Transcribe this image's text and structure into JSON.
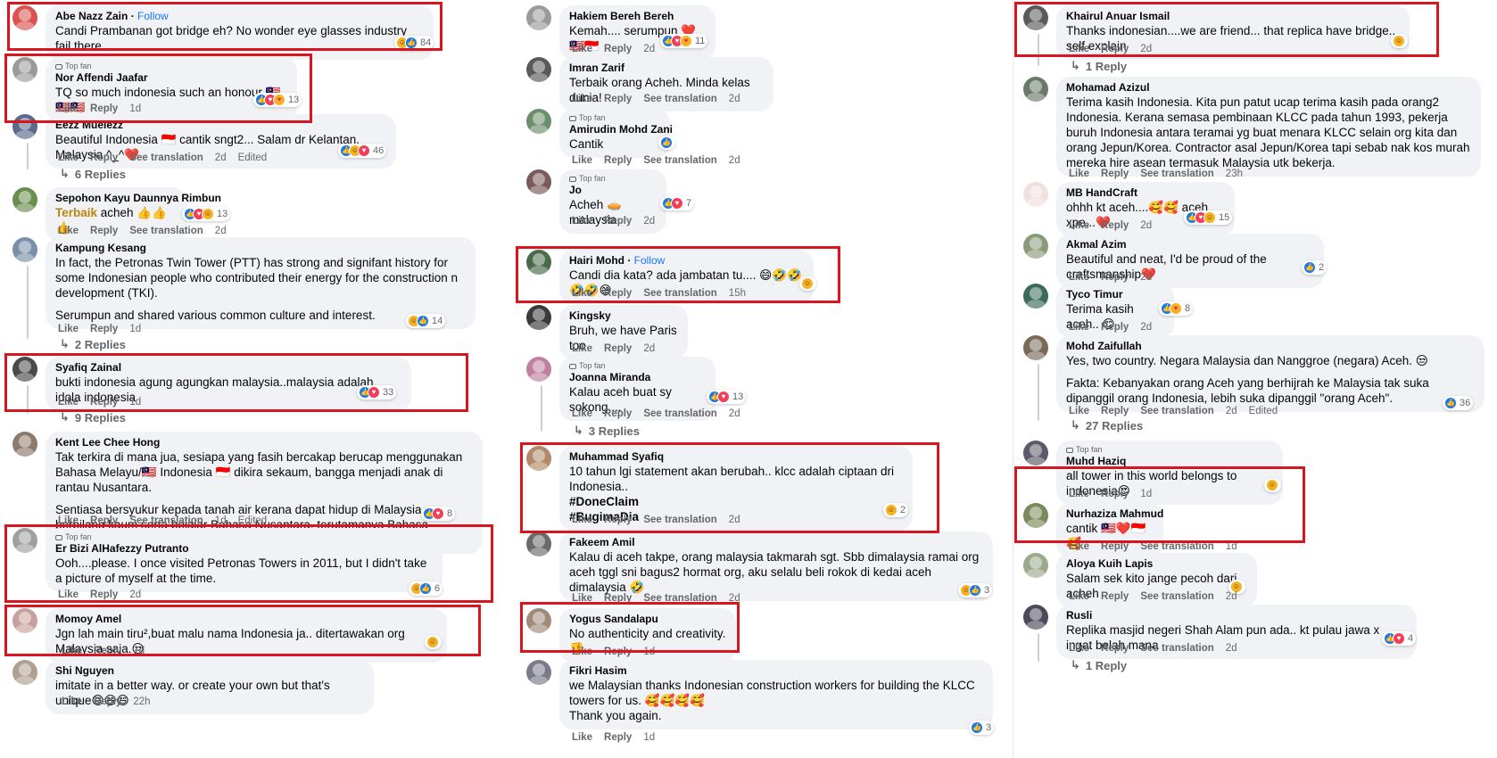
{
  "ui": {
    "like": "Like",
    "reply": "Reply",
    "see_translation": "See translation",
    "edited": "Edited",
    "top_fan": "Top fan",
    "follow": "Follow",
    "highlight_color": "#d9161f",
    "link_color": "#1877f2"
  },
  "columns": [
    {
      "comments": [
        {
          "name": "Abe Nazz Zain",
          "follow": true,
          "text": [
            "Candi Prambanan got bridge eh? No wonder eye glasses industry fail there."
          ],
          "time": "2d",
          "reactions": [
            "haha",
            "like"
          ],
          "count": "84",
          "avatar": "#d9534f"
        },
        {
          "name": "Nor Affendi Jaafar",
          "topfan": true,
          "text": [
            "TQ so much indonesia such an honour 🇲🇾🇲🇾🇲🇾"
          ],
          "time": "1d",
          "reactions": [
            "like",
            "love",
            "care"
          ],
          "count": "13",
          "avatar": "#9a9a9a"
        },
        {
          "name": "Eezz Mueiezz",
          "text": [
            "Beautiful Indonesia 🇮🇩 cantik sngt2... Salam dr Kelantan, Malaysia ^_^❤️"
          ],
          "time": "2d",
          "translate": true,
          "edited": true,
          "reactions": [
            "like",
            "haha",
            "love"
          ],
          "count": "46",
          "avatar": "#5a6b8c",
          "replies": "6 Replies"
        },
        {
          "name": "Sepohon Kayu Daunnya Rimbun",
          "text": [
            "Terbaik acheh 👍👍👍"
          ],
          "highlight": "Terbaik",
          "time": "2d",
          "translate": true,
          "reactions": [
            "like",
            "love",
            "haha"
          ],
          "count": "13",
          "avatar": "#6b8e4e"
        },
        {
          "name": "Kampung Kesang",
          "text": [
            "In fact, the Petronas Twin Tower (PTT) has strong and signifant history for some Indonesian people who contributed their energy for the construction n development (TKI).",
            "Serumpun and shared various common culture and interest."
          ],
          "time": "1d",
          "reactions": [
            "haha",
            "like"
          ],
          "count": "14",
          "avatar": "#7a8fa8",
          "replies": "2 Replies"
        },
        {
          "name": "Syafiq Zainal",
          "text": [
            "bukti indonesia agung agungkan malaysia..malaysia adalah idola indonesia"
          ],
          "time": "1d",
          "reactions": [
            "like",
            "love"
          ],
          "count": "33",
          "avatar": "#4a4a4a",
          "replies": "9 Replies"
        },
        {
          "name": "Kent Lee Chee Hong",
          "text": [
            "Tak terkira di mana jua, sesiapa yang fasih bercakap berucap menggunakan Bahasa Melayu/🇲🇾 Indonesia 🇮🇩 dikira sekaum, bangga menjadi anak di rantau Nusantara.",
            "Sentiasa bersyukur kepada tanah air kerana dapat hidup di Malaysia yang berbilang kaum serta belajar Bahasa Nusantara, terutamanya Bahasa Melayu."
          ],
          "time": "1d",
          "translate": true,
          "edited": true,
          "reactions": [
            "like",
            "love"
          ],
          "count": "8",
          "avatar": "#8c7a6b"
        },
        {
          "name": "Er Bizi AlHafezzy Putranto",
          "topfan": true,
          "text": [
            "Ooh....please. I once visited Petronas Towers in 2011, but I didn't take a picture of myself at the time."
          ],
          "time": "2d",
          "reactions": [
            "haha",
            "like"
          ],
          "count": "6",
          "avatar": "#a0a0a0"
        },
        {
          "name": "Momoy Amel",
          "text": [
            "Jgn lah main tiru²,buat malu nama Indonesia ja.. ditertawakan org Malaysia saja.😒"
          ],
          "time": "1d",
          "reactions": [
            "haha"
          ],
          "count": "",
          "avatar": "#c9a0a0"
        },
        {
          "name": "Shi Nguyen",
          "text": [
            "imitate in a better way. or create your own but that's unique😄😄😄"
          ],
          "time": "22h",
          "reactions": [],
          "count": "",
          "avatar": "#b0a090"
        }
      ]
    },
    {
      "comments": [
        {
          "name": "Hakiem Bereh Bereh",
          "text": [
            "Kemah.... serumpun ❤️🇲🇾🇮🇩"
          ],
          "time": "2d",
          "reactions": [
            "like",
            "love",
            "care"
          ],
          "count": "11",
          "avatar": "#9a9a9a"
        },
        {
          "name": "Imran Zarif",
          "text": [
            "Terbaik orang Acheh. Minda kelas dunia!"
          ],
          "time": "2d",
          "translate": true,
          "reactions": [],
          "count": "",
          "avatar": "#5a5a5a"
        },
        {
          "name": "Amirudin Mohd Zani",
          "topfan": true,
          "text": [
            "Cantik"
          ],
          "time": "2d",
          "translate": true,
          "reactions": [
            "like"
          ],
          "count": "",
          "avatar": "#6b8e6b"
        },
        {
          "name": "Jo",
          "topfan": true,
          "text": [
            "Acheh 🥧 malaysia"
          ],
          "time": "2d",
          "reactions": [
            "like",
            "love"
          ],
          "count": "7",
          "avatar": "#7a5a5a"
        },
        {
          "name": "Hairi Mohd",
          "follow": true,
          "text": [
            "Candi dia kata? ada jambatan tu.... 😄🤣🤣🤣🤣😄"
          ],
          "time": "15h",
          "translate": true,
          "reactions": [
            "haha"
          ],
          "count": "",
          "avatar": "#4a6a4a"
        },
        {
          "name": "Kingsky",
          "text": [
            "Bruh, we have Paris too"
          ],
          "time": "2d",
          "reactions": [],
          "count": "",
          "avatar": "#3a3a3a"
        },
        {
          "name": "Joanna Miranda",
          "topfan": true,
          "text": [
            "Kalau aceh buat sy sokong...."
          ],
          "time": "2d",
          "translate": true,
          "reactions": [
            "like",
            "love"
          ],
          "count": "13",
          "avatar": "#c080a0",
          "replies": "3 Replies"
        },
        {
          "name": "Muhammad Syafiq",
          "text": [
            "10 tahun lgi statement akan berubah.. klcc adalah ciptaan dri Indonesia..",
            "#DoneClaim",
            "#BugimaDia"
          ],
          "time": "2d",
          "translate": true,
          "reactions": [
            "haha"
          ],
          "count": "2",
          "avatar": "#b08a6b"
        },
        {
          "name": "Fakeem Amil",
          "text": [
            "Kalau di aceh takpe, orang malaysia takmarah sgt. Sbb dimalaysia ramai org aceh tggl sni bagus2 hormat org, aku selalu beli rokok di kedai aceh dimalaysia 🤣"
          ],
          "time": "2d",
          "translate": true,
          "reactions": [
            "haha",
            "like"
          ],
          "count": "3",
          "avatar": "#6a6a6a"
        },
        {
          "name": "Yogus Sandalapu",
          "text": [
            "No authenticity and creativity. 👎"
          ],
          "time": "1d",
          "reactions": [],
          "count": "",
          "avatar": "#a08a7a"
        },
        {
          "name": "Fikri Hasim",
          "text": [
            "we Malaysian thanks Indonesian construction workers for building the KLCC towers for us. 🥰🥰🥰🥰",
            "Thank you again."
          ],
          "time": "1d",
          "reactions": [
            "like"
          ],
          "count": "3",
          "avatar": "#7a7a8a"
        }
      ]
    },
    {
      "comments": [
        {
          "name": "Khairul Anuar Ismail",
          "text": [
            "Thanks indonesian....we are friend... that replica have bridge.. self explain"
          ],
          "time": "2d",
          "reactions": [
            "haha"
          ],
          "count": "",
          "avatar": "#5a5a5a",
          "replies": "1 Reply"
        },
        {
          "name": "Mohamad Azizul",
          "text": [
            "Terima kasih Indonesia. Kita pun patut ucap terima kasih pada orang2 Indonesia. Kerana semasa pembinaan KLCC pada tahun 1993, pekerja buruh Indonesia antara teramai yg buat menara KLCC selain org kita dan orang Jepun/Korea. Contractor asal Jepun/Korea tapi sebab nak kos murah mereka hire asean termasuk Malaysia utk bekerja."
          ],
          "time": "23h",
          "translate": true,
          "reactions": [],
          "count": "",
          "avatar": "#6a7a6a"
        },
        {
          "name": "MB HandCraft",
          "text": [
            "ohhh kt aceh....🥰🥰 aceh xpe...❤️"
          ],
          "time": "2d",
          "reactions": [
            "like",
            "love",
            "haha"
          ],
          "count": "15",
          "avatar": "#f0e0e0"
        },
        {
          "name": "Akmal Azim",
          "text": [
            "Beautiful and neat, I'd be proud of the craftsmanship❤️"
          ],
          "time": "2d",
          "reactions": [
            "like"
          ],
          "count": "2",
          "avatar": "#8a9a7a"
        },
        {
          "name": "Tyco Timur",
          "text": [
            "Terima kasih aceh.. 😊"
          ],
          "time": "2d",
          "reactions": [
            "like",
            "care"
          ],
          "count": "8",
          "avatar": "#3a6a5a"
        },
        {
          "name": "Mohd Zaifullah",
          "text": [
            "Yes, two country. Negara Malaysia dan Nanggroe (negara) Aceh. 😒",
            "Fakta: Kebanyakan orang Aceh yang berhijrah ke Malaysia tak suka dipanggil orang Indonesia, lebih suka dipanggil \"orang Aceh\"."
          ],
          "time": "2d",
          "translate": true,
          "edited": true,
          "reactions": [
            "like"
          ],
          "count": "36",
          "avatar": "#7a6a5a",
          "replies": "27 Replies"
        },
        {
          "name": "Muhd Haziq",
          "topfan": true,
          "text": [
            "all tower in this world belongs to indonesia😍"
          ],
          "time": "1d",
          "reactions": [
            "haha"
          ],
          "count": "",
          "avatar": "#5a5a6a"
        },
        {
          "name": "Nurhaziza Mahmud",
          "text": [
            "cantik 🇲🇾❤️🇮🇩🥰"
          ],
          "time": "1d",
          "translate": true,
          "reactions": [],
          "count": "",
          "avatar": "#7a8a5a"
        },
        {
          "name": "Aloya Kuih Lapis",
          "text": [
            "Salam sek kito jange pecoh dari acheh"
          ],
          "time": "2d",
          "translate": true,
          "reactions": [
            "haha"
          ],
          "count": "",
          "avatar": "#9aaa8a"
        },
        {
          "name": "Rusli",
          "text": [
            "Replika masjid negeri Shah Alam pun ada.. kt pulau jawa x ingat belah mana"
          ],
          "time": "2d",
          "translate": true,
          "reactions": [
            "like",
            "love"
          ],
          "count": "4",
          "avatar": "#4a4a5a",
          "replies": "1 Reply"
        }
      ]
    }
  ]
}
